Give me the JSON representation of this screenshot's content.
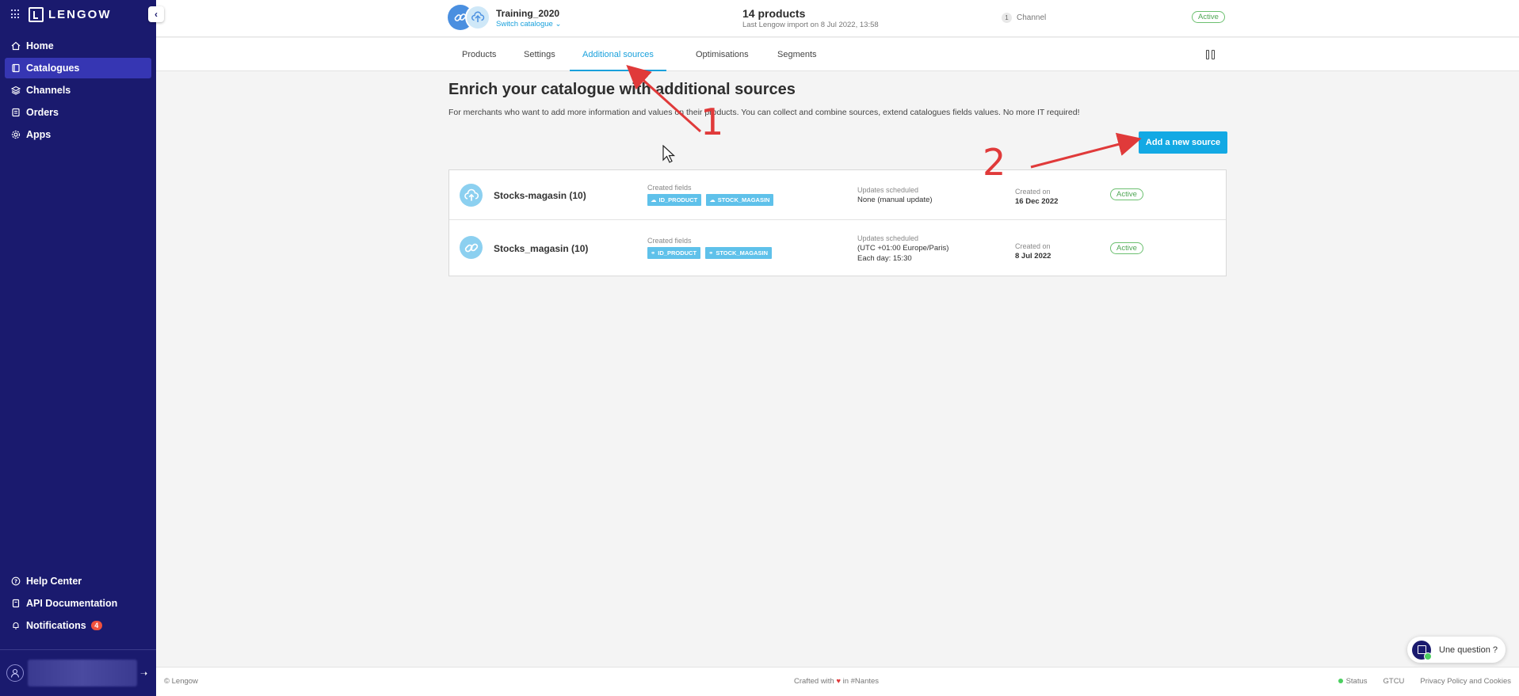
{
  "brand": {
    "name": "LENGOW"
  },
  "sidebar": {
    "items": [
      {
        "label": "Home",
        "icon": "home-icon"
      },
      {
        "label": "Catalogues",
        "icon": "book-icon",
        "active": true
      },
      {
        "label": "Channels",
        "icon": "layers-icon"
      },
      {
        "label": "Orders",
        "icon": "orders-icon"
      },
      {
        "label": "Apps",
        "icon": "gear-icon"
      }
    ],
    "bottom": [
      {
        "label": "Help Center",
        "icon": "help-icon"
      },
      {
        "label": "API Documentation",
        "icon": "document-icon"
      },
      {
        "label": "Notifications",
        "icon": "bell-icon",
        "badge": "4"
      }
    ]
  },
  "header": {
    "catalogue_name": "Training_2020",
    "switch_label": "Switch catalogue",
    "products_count": "14 products",
    "last_import": "Last Lengow import on 8 Jul 2022, 13:58",
    "channel_count": "1",
    "channel_label": "Channel",
    "status": "Active"
  },
  "tabs": [
    {
      "label": "Products"
    },
    {
      "label": "Settings"
    },
    {
      "label": "Additional sources",
      "active": true
    },
    {
      "label": "Optimisations"
    },
    {
      "label": "Segments"
    }
  ],
  "main": {
    "title": "Enrich your catalogue with additional sources",
    "subtitle": "For merchants who want to add more information and values on their products. You can collect and combine sources, extend catalogues fields values. No more IT required!",
    "add_button": "Add a new source"
  },
  "sources": [
    {
      "name": "Stocks-magasin (10)",
      "icon": "cloud-upload-icon",
      "fields_label": "Created fields",
      "fields": [
        "ID_PRODUCT",
        "STOCK_MAGASIN"
      ],
      "updates_label": "Updates scheduled",
      "updates": [
        "None (manual update)"
      ],
      "created_label": "Created on",
      "created": "16 Dec 2022",
      "status": "Active"
    },
    {
      "name": "Stocks_magasin (10)",
      "icon": "link-icon",
      "fields_label": "Created fields",
      "fields": [
        "ID_PRODUCT",
        "STOCK_MAGASIN"
      ],
      "updates_label": "Updates scheduled",
      "updates": [
        "(UTC +01:00 Europe/Paris)",
        "Each day: 15:30"
      ],
      "created_label": "Created on",
      "created": "8 Jul 2022",
      "status": "Active"
    }
  ],
  "annotations": {
    "one": "1",
    "two": "2",
    "color": "#e03a3a"
  },
  "chat": {
    "label": "Une question ?"
  },
  "footer": {
    "copyright": "© Lengow",
    "crafted_prefix": "Crafted with",
    "crafted_suffix": "in #Nantes",
    "status": "Status",
    "gtcu": "GTCU",
    "privacy": "Privacy Policy and Cookies"
  },
  "colors": {
    "sidebar": "#1a1a6e",
    "accent": "#13a9e4",
    "active_green": "#4fa654"
  }
}
